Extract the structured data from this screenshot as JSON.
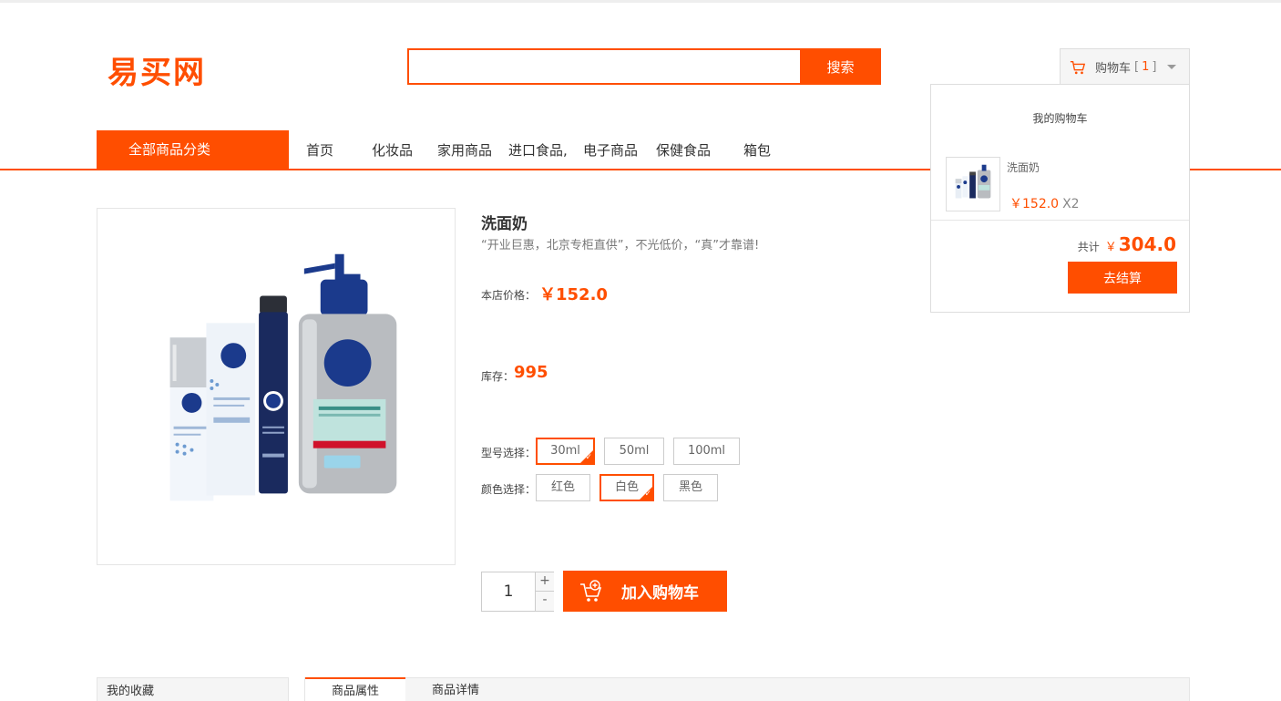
{
  "logo": "易买网",
  "search": {
    "placeholder": "",
    "button_label": "搜索"
  },
  "cart": {
    "label": "购物车",
    "count": "1",
    "bracket_open": "[",
    "bracket_close": "]",
    "dropdown": {
      "title": "我的购物车",
      "item": {
        "name": "洗面奶",
        "price": "￥152.0",
        "qty": "X2"
      },
      "total_label": "共计",
      "total_symbol": "￥",
      "total_amount": "304.0",
      "checkout_label": "去结算"
    }
  },
  "nav": {
    "all_categories": "全部商品分类",
    "items": [
      "首页",
      "化妆品",
      "家用商品",
      "进口食品,",
      "电子商品",
      "保健食品",
      "箱包"
    ]
  },
  "product": {
    "title": "洗面奶",
    "slogan": "“开业巨惠，北京专柜直供”，不光低价，“真”才靠谱!",
    "price_label": "本店价格：",
    "price": "￥152.0",
    "stock_label": "库存：",
    "stock": "995",
    "model_label": "型号选择：",
    "models": [
      "30ml",
      "50ml",
      "100ml"
    ],
    "selected_model": "30ml",
    "color_label": "颜色选择：",
    "colors": [
      "红色",
      "白色",
      "黑色"
    ],
    "selected_color": "白色",
    "quantity": "1",
    "qty_plus": "+",
    "qty_minus": "-",
    "add_to_cart_label": "加入购物车"
  },
  "bottom": {
    "favorites_label": "我的收藏",
    "tabs": [
      "商品属性",
      "商品详情"
    ],
    "active_tab": "商品属性"
  },
  "colors": {
    "accent": "#ff4e00",
    "border": "#dddddd"
  },
  "icons": [
    "cart-icon",
    "chevron-down-icon",
    "add-cart-icon",
    "check-icon"
  ]
}
